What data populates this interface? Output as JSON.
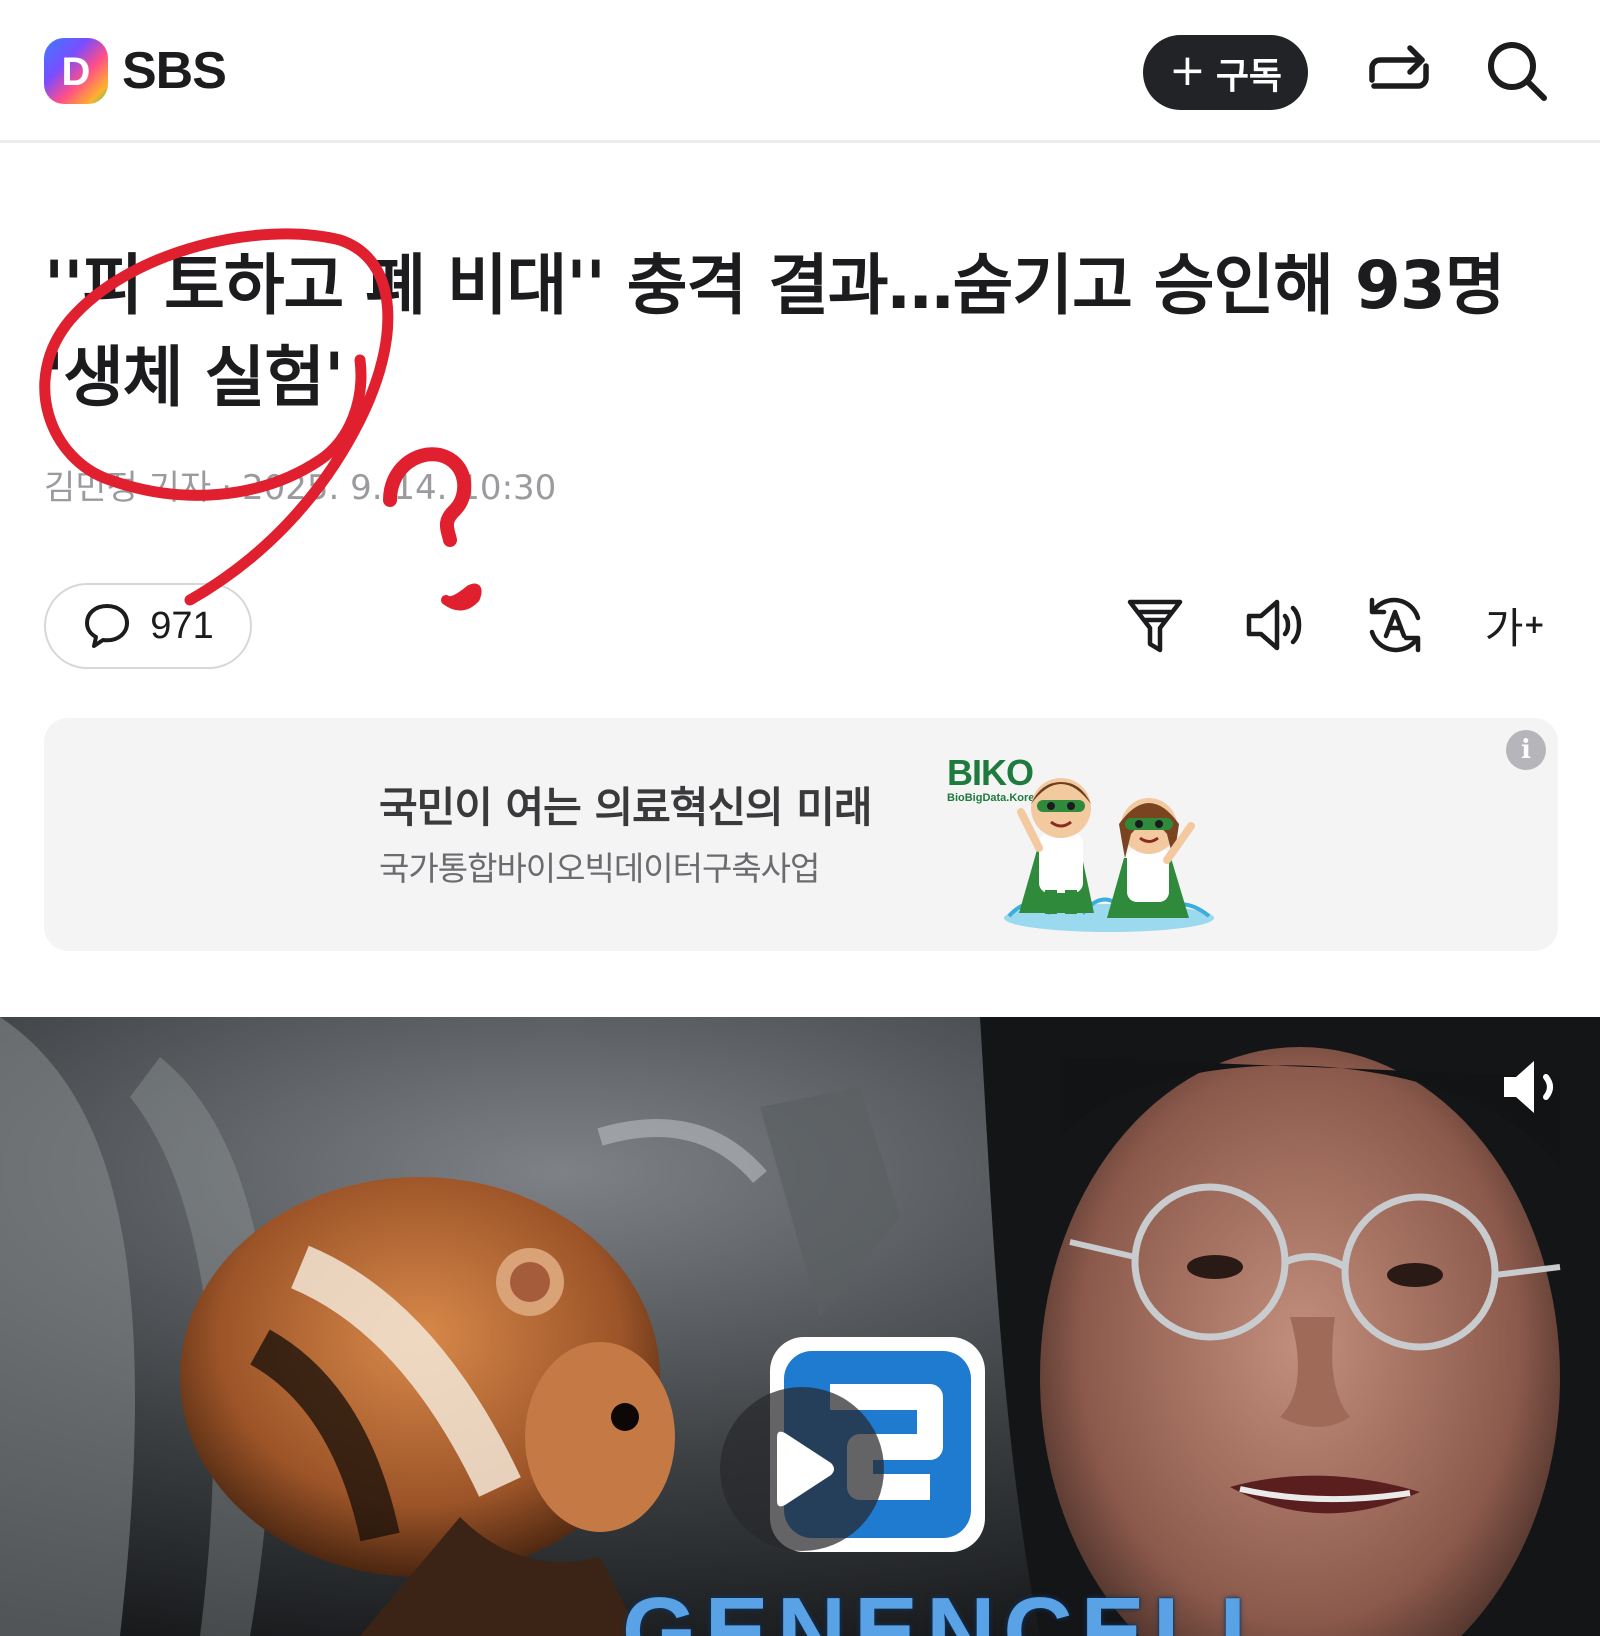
{
  "header": {
    "brand": "SBS",
    "logo_letter": "D",
    "subscribe_label": "구독",
    "subscribe_icon": "plus-icon",
    "share_icon": "share-icon",
    "search_icon": "search-icon"
  },
  "article": {
    "title": "''피 토하고 폐 비대'' 충격 결과…숨기고 승인해 93명 '생체 실험'",
    "author": "김민정 기자",
    "datetime": "2025. 9. 14. 10:30",
    "comment_count": "971"
  },
  "toolbar": {
    "summary_icon": "summary-filter-icon",
    "listen_icon": "speaker-icon",
    "translate_icon": "translate-icon",
    "font_size_label": "가",
    "font_size_sup": "+"
  },
  "ad": {
    "title": "국민이 여는 의료혁신의 미래",
    "subtitle": "국가통합바이오빅데이터구축사업",
    "brand": "BIKO",
    "brand_sub": "BioBigData.Korea",
    "info_label": "i"
  },
  "video": {
    "overlay_brand": "GENENCELL",
    "play_icon": "play-icon",
    "mute_icon": "volume-muted-icon"
  },
  "annotation": {
    "mark": "?"
  },
  "colors": {
    "text_primary": "#1c1c1e",
    "meta_gray": "#9b9b9f",
    "subscribe_bg": "#222326",
    "ad_bg": "#f4f4f5",
    "annotation_red": "#e0202f",
    "biko_green": "#1f7a3e"
  }
}
